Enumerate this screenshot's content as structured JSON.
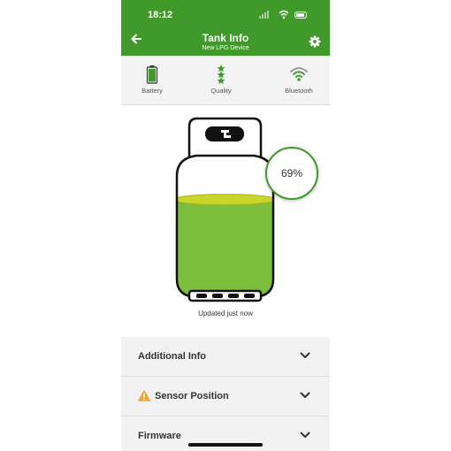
{
  "status_bar": {
    "time": "18:12"
  },
  "header": {
    "title": "Tank Info",
    "subtitle": "New LPG Device",
    "back_icon": "arrow-left-icon",
    "settings_icon": "gear-icon"
  },
  "stats": [
    {
      "label": "Battery",
      "icon": "battery-icon"
    },
    {
      "label": "Quality",
      "icon": "stars-icon"
    },
    {
      "label": "Bluetooth",
      "icon": "wifi-signal-icon"
    }
  ],
  "tank": {
    "level_text": "69%",
    "level_fraction": 0.69,
    "updated": "Updated just now",
    "fill_color": "#7dbd3c",
    "surface_color": "#c8d62a"
  },
  "sections": [
    {
      "label": "Additional Info",
      "warning": false
    },
    {
      "label": "Sensor Position",
      "warning": true
    },
    {
      "label": "Firmware",
      "warning": false
    }
  ],
  "colors": {
    "brand": "#3f9a2a",
    "warning": "#f0a530"
  }
}
